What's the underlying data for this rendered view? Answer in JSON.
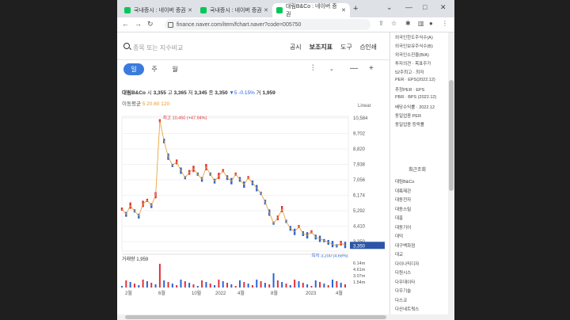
{
  "tabs": [
    {
      "label": "국내증시 : 네이버 증권",
      "active": false
    },
    {
      "label": "국내증시 : 네이버 증권",
      "active": false
    },
    {
      "label": "대림B&Co : 네이버 증권",
      "active": true
    }
  ],
  "url": "finance.naver.com/item/fchart.naver?code=005750",
  "search_placeholder": "종목 또는 지수비교",
  "toplinks": [
    "공시",
    "보조지표",
    "도구",
    "인쇄"
  ],
  "periods": [
    "일",
    "주",
    "월"
  ],
  "stock": {
    "name": "대림B&Co",
    "open_label": "시",
    "open": "3,355",
    "high_label": "고",
    "high": "3,365",
    "low_label": "저",
    "low": "3,345",
    "close_label": "종",
    "close": "3,350",
    "change": "▼5 -0.15%",
    "vol_label": "거",
    "volume": "1,959"
  },
  "ma": {
    "label": "이동평균",
    "ma5": "5 20.60 120"
  },
  "scale_label": "Linear",
  "chart_data": {
    "type": "line",
    "y_ticks": [
      "10,584",
      "9,702",
      "8,820",
      "7,938",
      "7,056",
      "6,174",
      "5,292",
      "4,410",
      "3,350"
    ],
    "x_ticks": [
      "2월",
      "6월",
      "10월",
      "2022",
      "4월",
      "8월",
      "2023",
      "4월"
    ],
    "max_label": "최고 10,450 (+47.94%)",
    "min_label": "최저 3,200 (4.68%)",
    "current_price": "3,350",
    "volume_label": "거래량",
    "volume_value": "1,959",
    "volume_ticks": [
      "6.14m",
      "4.61m",
      "3.07m",
      "1.54m"
    ],
    "price_series": [
      5400,
      5100,
      5600,
      5300,
      5000,
      5700,
      5900,
      5600,
      6200,
      10450,
      9300,
      8400,
      7900,
      8100,
      7600,
      7200,
      7500,
      7700,
      7400,
      7100,
      7800,
      7400,
      7000,
      7300,
      7600,
      7200,
      7000,
      7400,
      7100,
      6800,
      7200,
      6900,
      6600,
      6300,
      5800,
      5200,
      4600,
      4900,
      5400,
      4700,
      4300,
      4100,
      4400,
      4000,
      3900,
      4100,
      3800,
      3700,
      3600,
      3500,
      3400,
      3300,
      3450,
      3350
    ]
  },
  "sidebar": {
    "top_lines": [
      "외국인한도주식수(A)",
      "외국인보유주식수(B)",
      "외국인소진율(B/A)",
      "투자의견 · 목표주가",
      "52주최고 · 최저",
      "PER · EPS(2022.12)",
      "추정PER · EPS",
      "PBR · BPS (2022.12)",
      "배당수익률 · 2022.12",
      "동일업종 PER",
      "동일업종 등락률"
    ],
    "recent_head": "최근조회",
    "recent_items": [
      "대림B&Co",
      "대륙제관",
      "대동전자",
      "대동스틸",
      "대흥",
      "대동기어",
      "대덕",
      "대구백화점",
      "대교",
      "다이나믹디자",
      "다원시스",
      "다우데이타",
      "다우기술",
      "다스코",
      "다산네트웍스"
    ]
  }
}
